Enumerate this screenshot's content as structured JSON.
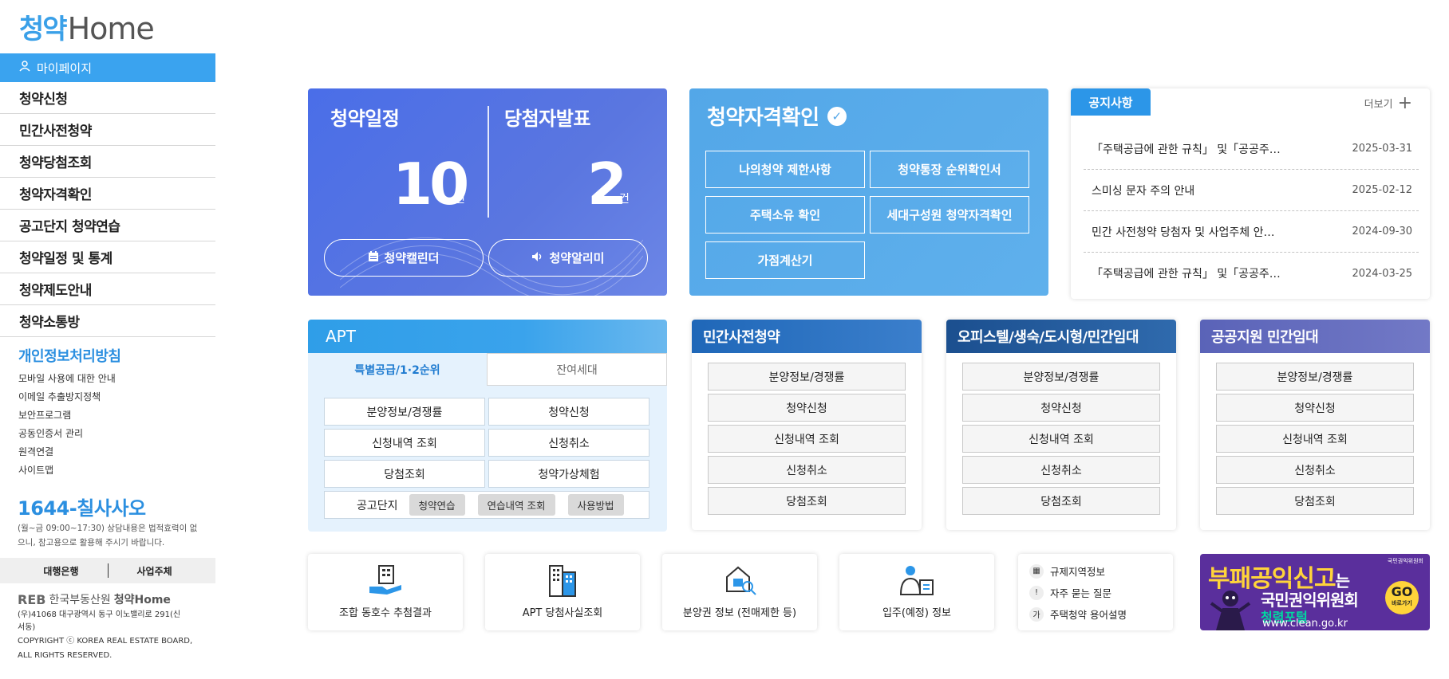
{
  "logo": {
    "part1": "청약",
    "part2": "Home"
  },
  "mypage": {
    "label": "마이페이지"
  },
  "menu": [
    {
      "label": "청약신청"
    },
    {
      "label": "민간사전청약"
    },
    {
      "label": "청약당첨조회"
    },
    {
      "label": "청약자격확인"
    },
    {
      "label": "공고단지 청약연습"
    },
    {
      "label": "청약일정 및 통계"
    },
    {
      "label": "청약제도안내"
    },
    {
      "label": "청약소통방"
    }
  ],
  "privacy": {
    "title": "개인정보처리방침"
  },
  "sublinks": [
    "모바일 사용에 대한 안내",
    "이메일 추출방지정책",
    "보안프로그램",
    "공동인증서 관리",
    "원격연결",
    "사이트맵"
  ],
  "contact": {
    "phone": "1644-칠사사오",
    "note": "(월~금 09:00~17:30) 상담내용은 법적효력이 없으니, 참고용으로 활용해 주시기 바랍니다."
  },
  "agency": {
    "bank": "대행은행",
    "business": "사업주체"
  },
  "footer": {
    "reb": "REB",
    "org": "한국부동산원",
    "home": "청약Home",
    "address": "(우)41068 대구광역시 동구 이노밸리로 291(신서동)",
    "copyright": "COPYRIGHT ⓒ KOREA REAL ESTATE BOARD, ALL RIGHTS RESERVED."
  },
  "schedule": {
    "title1": "청약일정",
    "count1": "10",
    "unit1": "건",
    "title2": "당첨자발표",
    "count2": "2",
    "unit2": "건",
    "btn_calendar": "청약캘린더",
    "btn_alarm": "청약알리미"
  },
  "qualification": {
    "title": "청약자격확인",
    "buttons": [
      "나의청약 제한사항",
      "청약통장 순위확인서",
      "주택소유 확인",
      "세대구성원 청약자격확인",
      "가점계산기"
    ]
  },
  "notice": {
    "tab": "공지사항",
    "more": "더보기",
    "items": [
      {
        "title": "「주택공급에 관한 규칙」 및「공공주…",
        "date": "2025-03-31"
      },
      {
        "title": "스미싱 문자 주의 안내",
        "date": "2025-02-12"
      },
      {
        "title": "민간 사전청약 당첨자 및 사업주체 안…",
        "date": "2024-09-30"
      },
      {
        "title": "「주택공급에 관한 규칙」 및「공공주…",
        "date": "2024-03-25"
      }
    ]
  },
  "apt": {
    "title": "APT",
    "tab_active": "특별공급/1·2순위",
    "tab_inactive": "잔여세대",
    "cells": [
      "분양정보/경쟁률",
      "청약신청",
      "신청내역 조회",
      "신청취소",
      "당첨조회",
      "청약가상체험"
    ],
    "practice_label": "공고단지",
    "practice_pills": [
      "청약연습",
      "연습내역 조회",
      "사용방법"
    ]
  },
  "categories": [
    {
      "title": "민간사전청약",
      "color": "#1f67b8",
      "items": [
        "분양정보/경쟁률",
        "청약신청",
        "신청내역 조회",
        "신청취소",
        "당첨조회"
      ]
    },
    {
      "title": "오피스텔/생숙/도시형/민간임대",
      "color": "#1b4f8f",
      "items": [
        "분양정보/경쟁률",
        "청약신청",
        "신청내역 조회",
        "신청취소",
        "당첨조회"
      ]
    },
    {
      "title": "공공지원 민간임대",
      "color": "#5a63b8",
      "items": [
        "분양정보/경쟁률",
        "청약신청",
        "신청내역 조회",
        "신청취소",
        "당첨조회"
      ]
    }
  ],
  "shortcuts": [
    {
      "label": "조합 동호수 추첨결과",
      "icon": "building-hand-icon"
    },
    {
      "label": "APT 당첨사실조회",
      "icon": "apartment-icon"
    },
    {
      "label": "분양권 정보 (전매제한 등)",
      "icon": "house-search-icon"
    },
    {
      "label": "입주(예정) 정보",
      "icon": "person-document-icon"
    }
  ],
  "links": [
    {
      "label": "규제지역정보",
      "icon": "building-icon"
    },
    {
      "label": "자주 묻는 질문",
      "icon": "exclamation-icon"
    },
    {
      "label": "주택청약 용어설명",
      "icon": "dictionary-icon"
    }
  ],
  "banner": {
    "headline": "부패공익신고",
    "headline_suffix": "는",
    "org": "국민권익위원회",
    "portal": "청렴포털",
    "url": "www.clean.go.kr",
    "go": "GO",
    "go_sub": "바로가기",
    "badge": "국민권익위원회"
  }
}
